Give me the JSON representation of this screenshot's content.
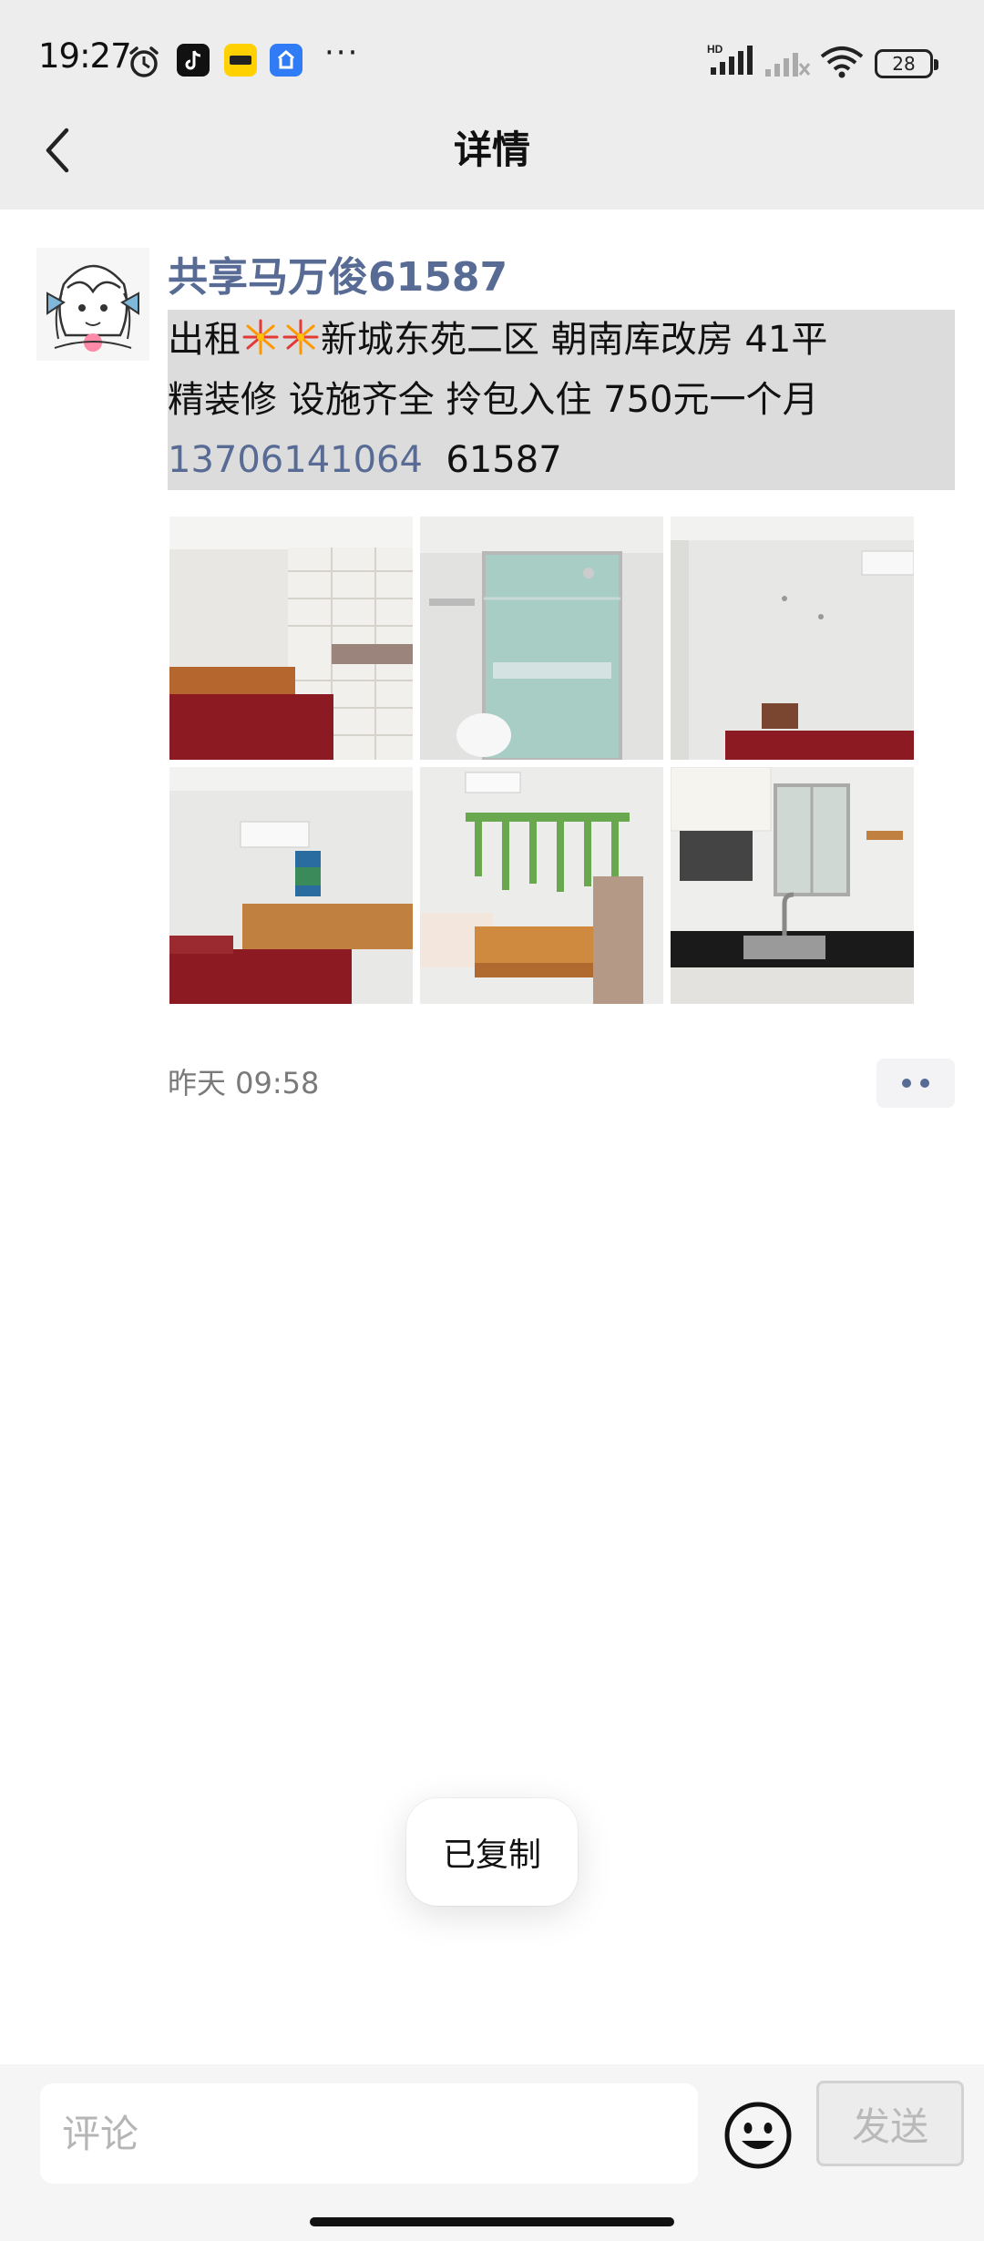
{
  "status_bar": {
    "time": "19:27",
    "more_icons": "···",
    "network_label": "HD",
    "battery": "28",
    "icons": [
      "alarm-icon",
      "tiktok-icon",
      "meituan-icon",
      "app-icon",
      "signal-icon",
      "signal-off-icon",
      "wifi-icon",
      "battery-icon"
    ]
  },
  "header": {
    "title": "详情",
    "back_icon": "chevron-left-icon"
  },
  "post": {
    "author": "共享马万俊61587",
    "line1_prefix": "出租",
    "line1_suffix": "新城东苑二区  朝南库改房  41平",
    "line2": "精装修  设施齐全 拎包入住  750元一个月",
    "phone": "13706141064",
    "code": "61587",
    "emoji": "fireworks-emoji",
    "time": "昨天 09:58",
    "photos": [
      {
        "name": "bedroom-wardrobe-photo"
      },
      {
        "name": "shower-photo"
      },
      {
        "name": "empty-room-ac-photo"
      },
      {
        "name": "bedroom-ac-photo"
      },
      {
        "name": "room-vines-fridge-photo"
      },
      {
        "name": "kitchen-photo"
      }
    ]
  },
  "toast": {
    "text": "已复制"
  },
  "comment_bar": {
    "placeholder": "评论",
    "send_label": "发送"
  },
  "colors": {
    "link": "#576b95",
    "header_bg": "#ededed",
    "selection_bg": "#dcdcdc"
  }
}
